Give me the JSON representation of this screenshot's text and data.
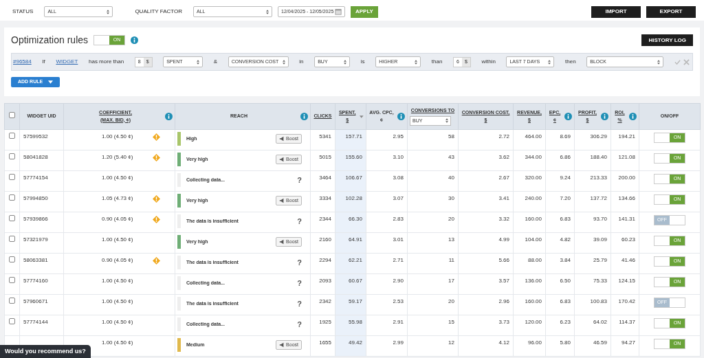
{
  "filters": [
    {
      "label": "STATUS",
      "value": "ALL"
    },
    {
      "label": "QUALITY FACTOR",
      "value": "ALL"
    }
  ],
  "date_range": "12/04/2025 - 12/05/2025",
  "apply_button": "APPLY",
  "header_buttons": [
    "IMPORT",
    "EXPORT"
  ],
  "rules": {
    "title": "Optimization rules",
    "toggle": {
      "label": "ON",
      "on": true
    },
    "history_button": "HISTORY LOG",
    "rule": [
      {
        "kind": "link",
        "text": "#96584"
      },
      {
        "kind": "text",
        "text": "If"
      },
      {
        "kind": "link",
        "text": "WIDGET"
      },
      {
        "kind": "text",
        "text": "has more than"
      },
      {
        "kind": "number",
        "value": "8",
        "unit": "$"
      },
      {
        "kind": "select",
        "value": "SPENT"
      },
      {
        "kind": "text",
        "text": "&"
      },
      {
        "kind": "select",
        "value": "CONVERSION COST"
      },
      {
        "kind": "text",
        "text": "in"
      },
      {
        "kind": "select",
        "value": "BUY"
      },
      {
        "kind": "text",
        "text": "is"
      },
      {
        "kind": "select",
        "value": "HIGHER"
      },
      {
        "kind": "text",
        "text": "than"
      },
      {
        "kind": "number",
        "value": "6",
        "unit": "$"
      },
      {
        "kind": "text",
        "text": "within"
      },
      {
        "kind": "select",
        "value": "LAST 7 DAYS"
      },
      {
        "kind": "text",
        "text": "then"
      },
      {
        "kind": "select",
        "value": "BLOCK"
      }
    ],
    "add_button": "ADD RULE"
  },
  "table": {
    "columns": [
      {
        "kind": "check",
        "checked": false
      },
      {
        "kind": "text",
        "label": "WIDGET UID"
      },
      {
        "kind": "text",
        "label": "COEFFICIENT,\n(MAX. BID, ¢)",
        "sortable": true,
        "info": true
      },
      {
        "kind": "text",
        "label": "REACH",
        "info": true
      },
      {
        "kind": "text",
        "label": "CLICKS",
        "sortable": true
      },
      {
        "kind": "text",
        "label": "SPENT, $",
        "sortable": true,
        "sorted": true
      },
      {
        "kind": "text",
        "label": "AVG. CPC, ¢",
        "info": true
      },
      {
        "kind": "select",
        "label": "CONVERSIONS TO",
        "value": "BUY",
        "sortable": true
      },
      {
        "kind": "text",
        "label": "CONVERSION COST, $",
        "sortable": true
      },
      {
        "kind": "text",
        "label": "REVENUE, $",
        "sortable": true
      },
      {
        "kind": "text",
        "label": "EPC, ¢",
        "sortable": true,
        "info": true
      },
      {
        "kind": "text",
        "label": "PROFIT, $",
        "sortable": true,
        "info": true
      },
      {
        "kind": "text",
        "label": "ROI, %",
        "sortable": true,
        "info": true
      },
      {
        "kind": "text",
        "label": "ON/OFF"
      }
    ],
    "rows": [
      {
        "checked": false,
        "uid": "57599532",
        "coefficient": "1.00 (4.50 ¢)",
        "warning": true,
        "reach": {
          "kind": "boost",
          "label": "High",
          "color": "#a8c56a",
          "button": "Boost"
        },
        "clicks": "5341",
        "spent": "157.71",
        "avg_cpc": "2.95",
        "conversions": "58",
        "conversion_cost": "2.72",
        "revenue": "464.00",
        "epc": "8.69",
        "profit": "306.29",
        "roi": "194.21",
        "status": {
          "label": "ON",
          "on": true
        }
      },
      {
        "checked": false,
        "uid": "58041828",
        "coefficient": "1.20 (5.40 ¢)",
        "warning": true,
        "reach": {
          "kind": "boost",
          "label": "Very high",
          "color": "#6fae76",
          "button": "Boost"
        },
        "clicks": "5015",
        "spent": "155.60",
        "avg_cpc": "3.10",
        "conversions": "43",
        "conversion_cost": "3.62",
        "revenue": "344.00",
        "epc": "6.86",
        "profit": "188.40",
        "roi": "121.08",
        "status": {
          "label": "ON",
          "on": true
        }
      },
      {
        "checked": false,
        "uid": "57774154",
        "coefficient": "1.00 (4.50 ¢)",
        "warning": false,
        "reach": {
          "kind": "unknown",
          "label": "Collecting data...",
          "color": "#eeeeee",
          "button": "?"
        },
        "clicks": "3464",
        "spent": "106.67",
        "avg_cpc": "3.08",
        "conversions": "40",
        "conversion_cost": "2.67",
        "revenue": "320.00",
        "epc": "9.24",
        "profit": "213.33",
        "roi": "200.00",
        "status": {
          "label": "ON",
          "on": true
        }
      },
      {
        "checked": false,
        "uid": "57994850",
        "coefficient": "1.05 (4.73 ¢)",
        "warning": true,
        "reach": {
          "kind": "boost",
          "label": "Very high",
          "color": "#6fae76",
          "button": "Boost"
        },
        "clicks": "3334",
        "spent": "102.28",
        "avg_cpc": "3.07",
        "conversions": "30",
        "conversion_cost": "3.41",
        "revenue": "240.00",
        "epc": "7.20",
        "profit": "137.72",
        "roi": "134.66",
        "status": {
          "label": "ON",
          "on": true
        }
      },
      {
        "checked": false,
        "uid": "57939866",
        "coefficient": "0.90 (4.05 ¢)",
        "warning": true,
        "reach": {
          "kind": "unknown",
          "label": "The data is insufficient",
          "color": "#eeeeee",
          "button": "?"
        },
        "clicks": "2344",
        "spent": "66.30",
        "avg_cpc": "2.83",
        "conversions": "20",
        "conversion_cost": "3.32",
        "revenue": "160.00",
        "epc": "6.83",
        "profit": "93.70",
        "roi": "141.31",
        "status": {
          "label": "OFF",
          "on": false
        }
      },
      {
        "checked": false,
        "uid": "57321979",
        "coefficient": "1.00 (4.50 ¢)",
        "warning": false,
        "reach": {
          "kind": "boost",
          "label": "Very high",
          "color": "#6fae76",
          "button": "Boost"
        },
        "clicks": "2160",
        "spent": "64.91",
        "avg_cpc": "3.01",
        "conversions": "13",
        "conversion_cost": "4.99",
        "revenue": "104.00",
        "epc": "4.82",
        "profit": "39.09",
        "roi": "60.23",
        "status": {
          "label": "ON",
          "on": true
        }
      },
      {
        "checked": false,
        "uid": "58063381",
        "coefficient": "0.90 (4.05 ¢)",
        "warning": true,
        "reach": {
          "kind": "unknown",
          "label": "The data is insufficient",
          "color": "#eeeeee",
          "button": "?"
        },
        "clicks": "2294",
        "spent": "62.21",
        "avg_cpc": "2.71",
        "conversions": "11",
        "conversion_cost": "5.66",
        "revenue": "88.00",
        "epc": "3.84",
        "profit": "25.79",
        "roi": "41.46",
        "status": {
          "label": "ON",
          "on": true
        }
      },
      {
        "checked": false,
        "uid": "57774160",
        "coefficient": "1.00 (4.50 ¢)",
        "warning": false,
        "reach": {
          "kind": "unknown",
          "label": "Collecting data...",
          "color": "#eeeeee",
          "button": "?"
        },
        "clicks": "2093",
        "spent": "60.67",
        "avg_cpc": "2.90",
        "conversions": "17",
        "conversion_cost": "3.57",
        "revenue": "136.00",
        "epc": "6.50",
        "profit": "75.33",
        "roi": "124.15",
        "status": {
          "label": "ON",
          "on": true
        }
      },
      {
        "checked": false,
        "uid": "57960671",
        "coefficient": "1.00 (4.50 ¢)",
        "warning": false,
        "reach": {
          "kind": "unknown",
          "label": "The data is insufficient",
          "color": "#eeeeee",
          "button": "?"
        },
        "clicks": "2342",
        "spent": "59.17",
        "avg_cpc": "2.53",
        "conversions": "20",
        "conversion_cost": "2.96",
        "revenue": "160.00",
        "epc": "6.83",
        "profit": "100.83",
        "roi": "170.42",
        "status": {
          "label": "OFF",
          "on": false
        }
      },
      {
        "checked": false,
        "uid": "57774144",
        "coefficient": "1.00 (4.50 ¢)",
        "warning": false,
        "reach": {
          "kind": "unknown",
          "label": "Collecting data...",
          "color": "#eeeeee",
          "button": "?"
        },
        "clicks": "1925",
        "spent": "55.98",
        "avg_cpc": "2.91",
        "conversions": "15",
        "conversion_cost": "3.73",
        "revenue": "120.00",
        "epc": "6.23",
        "profit": "64.02",
        "roi": "114.37",
        "status": {
          "label": "ON",
          "on": true
        }
      },
      {
        "coefficient": "1.00 (4.50 ¢)",
        "warning": false,
        "reach": {
          "kind": "boost",
          "label": "Medium",
          "color": "#e0b94c",
          "button": "Boost"
        },
        "clicks": "1655",
        "spent": "49.42",
        "avg_cpc": "2.99",
        "conversions": "12",
        "conversion_cost": "4.12",
        "revenue": "96.00",
        "epc": "5.80",
        "profit": "46.59",
        "roi": "94.27",
        "status": {
          "label": "ON",
          "on": true
        }
      }
    ]
  },
  "feedback_tab": "Would you recommend us?"
}
